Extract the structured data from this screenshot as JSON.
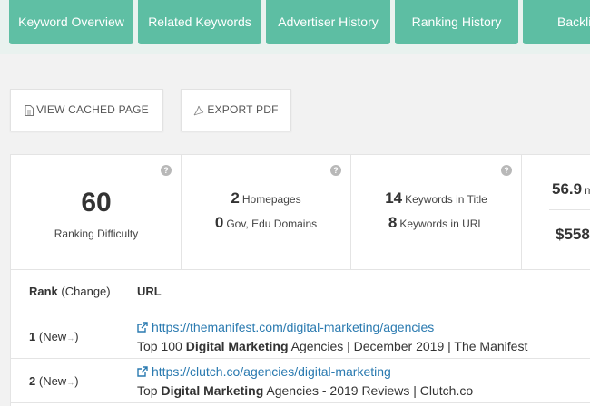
{
  "tabs": [
    {
      "label": "Keyword Overview"
    },
    {
      "label": "Related Keywords"
    },
    {
      "label": "Advertiser History"
    },
    {
      "label": "Ranking History"
    },
    {
      "label": "Backli"
    }
  ],
  "buttons": {
    "cached": "VIEW CACHED PAGE",
    "pdf": "EXPORT PDF"
  },
  "stats": {
    "difficulty_value": "60",
    "difficulty_label": "Ranking Difficulty",
    "homepages_value": "2",
    "homepages_label": "Homepages",
    "gov_value": "0",
    "gov_label": "Gov, Edu Domains",
    "title_value": "14",
    "title_label": "Keywords in Title",
    "url_value": "8",
    "url_label": "Keywords in URL",
    "partial_value_1": "56.9",
    "partial_suffix_1": "m",
    "partial_value_2": "$558",
    "help_glyph": "?"
  },
  "table": {
    "col_rank": "Rank",
    "col_change": "(Change)",
    "col_url": "URL",
    "rows": [
      {
        "rank": "1",
        "change": "(New",
        "change_arrow": "→",
        "change_close": ")",
        "url": "https://themanifest.com/digital-marketing/agencies",
        "desc_pre": "Top 100 ",
        "desc_bold": "Digital Marketing",
        "desc_post": " Agencies | December 2019 | The Manifest"
      },
      {
        "rank": "2",
        "change": "(New",
        "change_arrow": "→",
        "change_close": ")",
        "url": "https://clutch.co/agencies/digital-marketing",
        "desc_pre": "Top ",
        "desc_bold": "Digital Marketing",
        "desc_post": " Agencies - 2019 Reviews | Clutch.co"
      }
    ]
  },
  "colors": {
    "tab_bg": "#5dbea3",
    "link": "#2a7ab0",
    "page_bg": "#f2f2f2"
  },
  "icons": {
    "cached": "document-icon",
    "pdf": "pdf-icon",
    "help": "help-icon",
    "link": "external-link-icon"
  }
}
